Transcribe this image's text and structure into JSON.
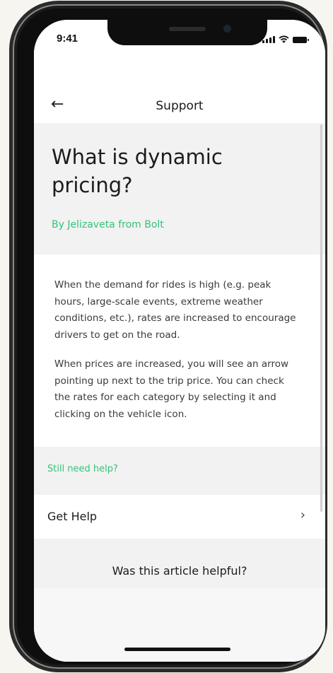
{
  "status_bar": {
    "time": "9:41"
  },
  "nav": {
    "back_icon": "←",
    "title": "Support"
  },
  "article": {
    "title": "What is dynamic pricing?",
    "author": "By Jelizaveta from Bolt",
    "paragraphs": [
      "When the demand for rides is high (e.g. peak hours, large-scale events, extreme weather conditions, etc.), rates are increased to encourage drivers to get on the road.",
      "When prices are increased, you will see an arrow pointing up next to the trip price. You can check the rates for each category by selecting it and clicking on the vehicle icon."
    ]
  },
  "help": {
    "section_label": "Still need help?",
    "get_help_label": "Get Help",
    "chevron_icon": "›"
  },
  "feedback": {
    "question": "Was this article helpful?"
  },
  "colors": {
    "accent_green": "#34c27a",
    "background_gray": "#f2f2f2"
  }
}
